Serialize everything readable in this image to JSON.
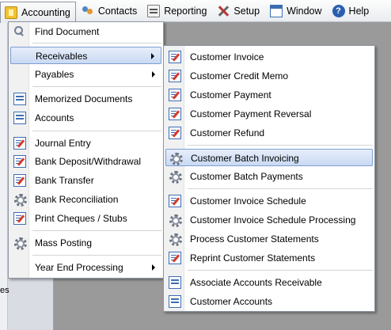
{
  "menubar": {
    "items": [
      {
        "label": "Accounting",
        "icon": "accounting-icon"
      },
      {
        "label": "Contacts",
        "icon": "contacts-icon"
      },
      {
        "label": "Reporting",
        "icon": "reporting-icon"
      },
      {
        "label": "Setup",
        "icon": "setup-icon"
      },
      {
        "label": "Window",
        "icon": "window-icon"
      },
      {
        "label": "Help",
        "icon": "help-icon"
      }
    ]
  },
  "accounting_menu": {
    "items": [
      {
        "label": "Find Document",
        "icon": "search-icon"
      },
      {
        "label": "Receivables",
        "icon": "",
        "submenu": true,
        "highlighted": true
      },
      {
        "label": "Payables",
        "icon": "",
        "submenu": true
      },
      {
        "label": "Memorized Documents",
        "icon": "list-icon"
      },
      {
        "label": "Accounts",
        "icon": "list-icon"
      },
      {
        "label": "Journal Entry",
        "icon": "document-edit-icon"
      },
      {
        "label": "Bank Deposit/Withdrawal",
        "icon": "document-edit-icon"
      },
      {
        "label": "Bank Transfer",
        "icon": "document-edit-icon"
      },
      {
        "label": "Bank Reconciliation",
        "icon": "gear-icon"
      },
      {
        "label": "Print Cheques / Stubs",
        "icon": "document-edit-icon"
      },
      {
        "label": "Mass Posting",
        "icon": "gear-icon"
      },
      {
        "label": "Year End Processing",
        "icon": "",
        "submenu": true
      }
    ]
  },
  "receivables_menu": {
    "items": [
      {
        "label": "Customer Invoice",
        "icon": "document-edit-icon"
      },
      {
        "label": "Customer Credit Memo",
        "icon": "document-edit-icon"
      },
      {
        "label": "Customer Payment",
        "icon": "document-edit-icon"
      },
      {
        "label": "Customer Payment Reversal",
        "icon": "document-edit-icon"
      },
      {
        "label": "Customer Refund",
        "icon": "document-edit-icon"
      },
      {
        "label": "Customer Batch Invoicing",
        "icon": "gear-icon",
        "highlighted": true
      },
      {
        "label": "Customer Batch Payments",
        "icon": "gear-icon"
      },
      {
        "label": "Customer Invoice Schedule",
        "icon": "document-edit-icon"
      },
      {
        "label": "Customer Invoice Schedule Processing",
        "icon": "gear-icon"
      },
      {
        "label": "Process Customer Statements",
        "icon": "gear-icon"
      },
      {
        "label": "Reprint Customer Statements",
        "icon": "document-edit-icon"
      },
      {
        "label": "Associate Accounts Receivable",
        "icon": "list-icon"
      },
      {
        "label": "Customer Accounts",
        "icon": "list-icon"
      }
    ]
  },
  "background": {
    "left_panel_text": "es"
  },
  "colors": {
    "highlight_border": "#7d9ed2",
    "highlight_fill": "#c9daf3",
    "menu_border": "#8e97a3",
    "workspace": "#9a9a9a"
  }
}
